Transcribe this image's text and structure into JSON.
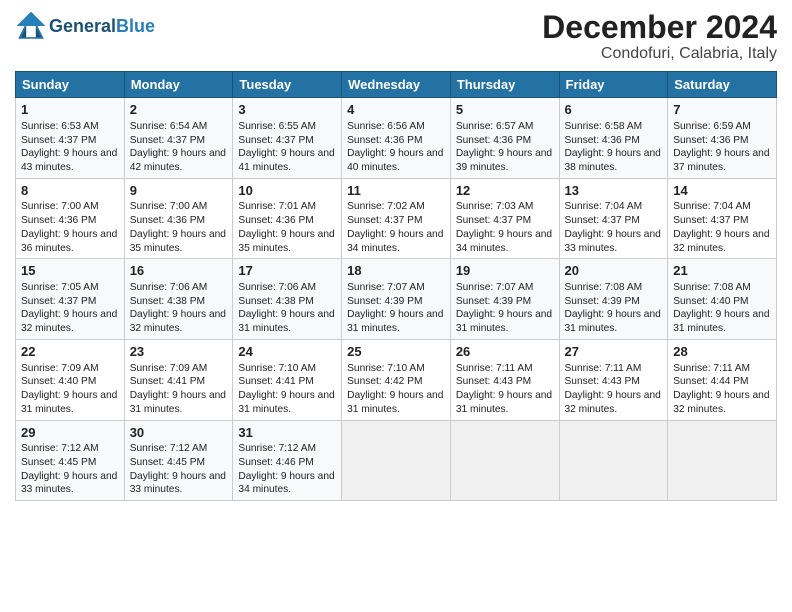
{
  "header": {
    "logo_general": "General",
    "logo_blue": "Blue",
    "title": "December 2024",
    "subtitle": "Condofuri, Calabria, Italy"
  },
  "days_of_week": [
    "Sunday",
    "Monday",
    "Tuesday",
    "Wednesday",
    "Thursday",
    "Friday",
    "Saturday"
  ],
  "weeks": [
    [
      {
        "day": "1",
        "sunrise": "Sunrise: 6:53 AM",
        "sunset": "Sunset: 4:37 PM",
        "daylight": "Daylight: 9 hours and 43 minutes."
      },
      {
        "day": "2",
        "sunrise": "Sunrise: 6:54 AM",
        "sunset": "Sunset: 4:37 PM",
        "daylight": "Daylight: 9 hours and 42 minutes."
      },
      {
        "day": "3",
        "sunrise": "Sunrise: 6:55 AM",
        "sunset": "Sunset: 4:37 PM",
        "daylight": "Daylight: 9 hours and 41 minutes."
      },
      {
        "day": "4",
        "sunrise": "Sunrise: 6:56 AM",
        "sunset": "Sunset: 4:36 PM",
        "daylight": "Daylight: 9 hours and 40 minutes."
      },
      {
        "day": "5",
        "sunrise": "Sunrise: 6:57 AM",
        "sunset": "Sunset: 4:36 PM",
        "daylight": "Daylight: 9 hours and 39 minutes."
      },
      {
        "day": "6",
        "sunrise": "Sunrise: 6:58 AM",
        "sunset": "Sunset: 4:36 PM",
        "daylight": "Daylight: 9 hours and 38 minutes."
      },
      {
        "day": "7",
        "sunrise": "Sunrise: 6:59 AM",
        "sunset": "Sunset: 4:36 PM",
        "daylight": "Daylight: 9 hours and 37 minutes."
      }
    ],
    [
      {
        "day": "8",
        "sunrise": "Sunrise: 7:00 AM",
        "sunset": "Sunset: 4:36 PM",
        "daylight": "Daylight: 9 hours and 36 minutes."
      },
      {
        "day": "9",
        "sunrise": "Sunrise: 7:00 AM",
        "sunset": "Sunset: 4:36 PM",
        "daylight": "Daylight: 9 hours and 35 minutes."
      },
      {
        "day": "10",
        "sunrise": "Sunrise: 7:01 AM",
        "sunset": "Sunset: 4:36 PM",
        "daylight": "Daylight: 9 hours and 35 minutes."
      },
      {
        "day": "11",
        "sunrise": "Sunrise: 7:02 AM",
        "sunset": "Sunset: 4:37 PM",
        "daylight": "Daylight: 9 hours and 34 minutes."
      },
      {
        "day": "12",
        "sunrise": "Sunrise: 7:03 AM",
        "sunset": "Sunset: 4:37 PM",
        "daylight": "Daylight: 9 hours and 34 minutes."
      },
      {
        "day": "13",
        "sunrise": "Sunrise: 7:04 AM",
        "sunset": "Sunset: 4:37 PM",
        "daylight": "Daylight: 9 hours and 33 minutes."
      },
      {
        "day": "14",
        "sunrise": "Sunrise: 7:04 AM",
        "sunset": "Sunset: 4:37 PM",
        "daylight": "Daylight: 9 hours and 32 minutes."
      }
    ],
    [
      {
        "day": "15",
        "sunrise": "Sunrise: 7:05 AM",
        "sunset": "Sunset: 4:37 PM",
        "daylight": "Daylight: 9 hours and 32 minutes."
      },
      {
        "day": "16",
        "sunrise": "Sunrise: 7:06 AM",
        "sunset": "Sunset: 4:38 PM",
        "daylight": "Daylight: 9 hours and 32 minutes."
      },
      {
        "day": "17",
        "sunrise": "Sunrise: 7:06 AM",
        "sunset": "Sunset: 4:38 PM",
        "daylight": "Daylight: 9 hours and 31 minutes."
      },
      {
        "day": "18",
        "sunrise": "Sunrise: 7:07 AM",
        "sunset": "Sunset: 4:39 PM",
        "daylight": "Daylight: 9 hours and 31 minutes."
      },
      {
        "day": "19",
        "sunrise": "Sunrise: 7:07 AM",
        "sunset": "Sunset: 4:39 PM",
        "daylight": "Daylight: 9 hours and 31 minutes."
      },
      {
        "day": "20",
        "sunrise": "Sunrise: 7:08 AM",
        "sunset": "Sunset: 4:39 PM",
        "daylight": "Daylight: 9 hours and 31 minutes."
      },
      {
        "day": "21",
        "sunrise": "Sunrise: 7:08 AM",
        "sunset": "Sunset: 4:40 PM",
        "daylight": "Daylight: 9 hours and 31 minutes."
      }
    ],
    [
      {
        "day": "22",
        "sunrise": "Sunrise: 7:09 AM",
        "sunset": "Sunset: 4:40 PM",
        "daylight": "Daylight: 9 hours and 31 minutes."
      },
      {
        "day": "23",
        "sunrise": "Sunrise: 7:09 AM",
        "sunset": "Sunset: 4:41 PM",
        "daylight": "Daylight: 9 hours and 31 minutes."
      },
      {
        "day": "24",
        "sunrise": "Sunrise: 7:10 AM",
        "sunset": "Sunset: 4:41 PM",
        "daylight": "Daylight: 9 hours and 31 minutes."
      },
      {
        "day": "25",
        "sunrise": "Sunrise: 7:10 AM",
        "sunset": "Sunset: 4:42 PM",
        "daylight": "Daylight: 9 hours and 31 minutes."
      },
      {
        "day": "26",
        "sunrise": "Sunrise: 7:11 AM",
        "sunset": "Sunset: 4:43 PM",
        "daylight": "Daylight: 9 hours and 31 minutes."
      },
      {
        "day": "27",
        "sunrise": "Sunrise: 7:11 AM",
        "sunset": "Sunset: 4:43 PM",
        "daylight": "Daylight: 9 hours and 32 minutes."
      },
      {
        "day": "28",
        "sunrise": "Sunrise: 7:11 AM",
        "sunset": "Sunset: 4:44 PM",
        "daylight": "Daylight: 9 hours and 32 minutes."
      }
    ],
    [
      {
        "day": "29",
        "sunrise": "Sunrise: 7:12 AM",
        "sunset": "Sunset: 4:45 PM",
        "daylight": "Daylight: 9 hours and 33 minutes."
      },
      {
        "day": "30",
        "sunrise": "Sunrise: 7:12 AM",
        "sunset": "Sunset: 4:45 PM",
        "daylight": "Daylight: 9 hours and 33 minutes."
      },
      {
        "day": "31",
        "sunrise": "Sunrise: 7:12 AM",
        "sunset": "Sunset: 4:46 PM",
        "daylight": "Daylight: 9 hours and 34 minutes."
      },
      null,
      null,
      null,
      null
    ]
  ]
}
